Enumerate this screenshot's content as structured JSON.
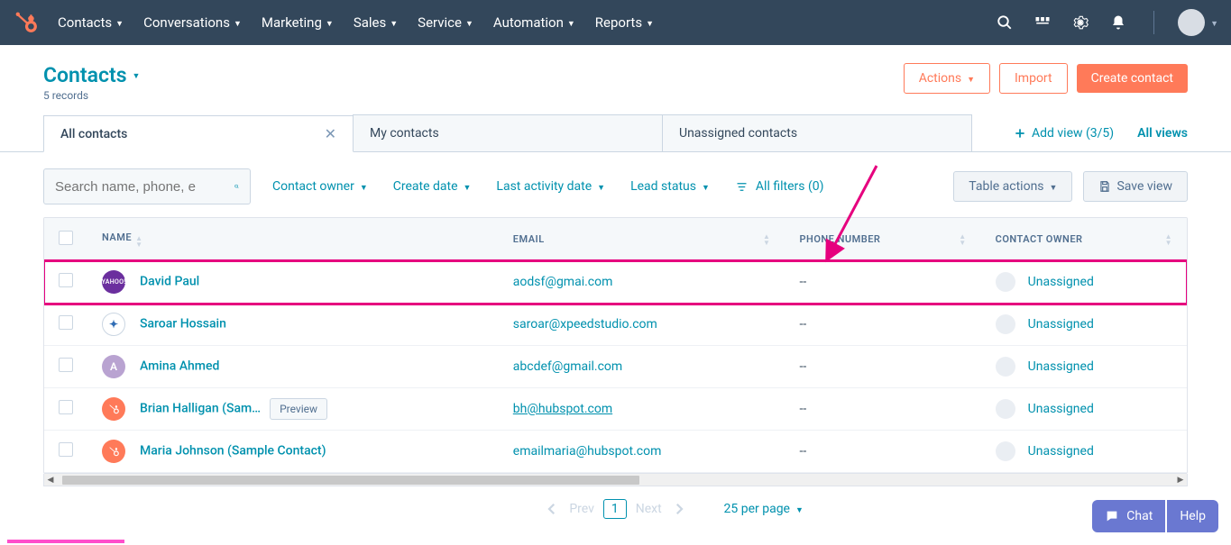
{
  "nav": {
    "items": [
      "Contacts",
      "Conversations",
      "Marketing",
      "Sales",
      "Service",
      "Automation",
      "Reports"
    ]
  },
  "header": {
    "title": "Contacts",
    "records": "5 records",
    "actions_btn": "Actions",
    "import_btn": "Import",
    "create_btn": "Create contact"
  },
  "tabs": {
    "items": [
      "All contacts",
      "My contacts",
      "Unassigned contacts"
    ],
    "add_view": "Add view (3/5)",
    "all_views": "All views"
  },
  "filters": {
    "search_placeholder": "Search name, phone, e",
    "owner": "Contact owner",
    "create": "Create date",
    "activity": "Last activity date",
    "lead": "Lead status",
    "all_filters": "All filters (0)",
    "table_actions": "Table actions",
    "save_view": "Save view"
  },
  "table": {
    "headers": {
      "name": "NAME",
      "email": "EMAIL",
      "phone": "PHONE NUMBER",
      "owner": "CONTACT OWNER"
    },
    "rows": [
      {
        "name": "David Paul",
        "email": "aodsf@gmai.com",
        "phone": "--",
        "owner": "Unassigned",
        "avatar_bg": "#6b2f9e",
        "avatar_text": "",
        "highlighted": true,
        "preview": false,
        "underline_email": false
      },
      {
        "name": "Saroar Hossain",
        "email": "saroar@xpeedstudio.com",
        "phone": "--",
        "owner": "Unassigned",
        "avatar_bg": "#ffffff",
        "avatar_text": "✦",
        "highlighted": false,
        "preview": false,
        "underline_email": false
      },
      {
        "name": "Amina Ahmed",
        "email": "abcdef@gmail.com",
        "phone": "--",
        "owner": "Unassigned",
        "avatar_bg": "#b9a3d1",
        "avatar_text": "A",
        "highlighted": false,
        "preview": false,
        "underline_email": false
      },
      {
        "name": "Brian Halligan (Sam…",
        "email": "bh@hubspot.com",
        "phone": "--",
        "owner": "Unassigned",
        "avatar_bg": "#ff7a59",
        "avatar_text": "",
        "highlighted": false,
        "preview": true,
        "underline_email": true
      },
      {
        "name": "Maria Johnson (Sample Contact)",
        "email": "emailmaria@hubspot.com",
        "phone": "--",
        "owner": "Unassigned",
        "avatar_bg": "#ff7a59",
        "avatar_text": "",
        "highlighted": false,
        "preview": false,
        "underline_email": false
      }
    ],
    "preview_label": "Preview"
  },
  "pagination": {
    "prev": "Prev",
    "page": "1",
    "next": "Next",
    "perpage": "25 per page"
  },
  "widgets": {
    "chat": "Chat",
    "help": "Help"
  }
}
